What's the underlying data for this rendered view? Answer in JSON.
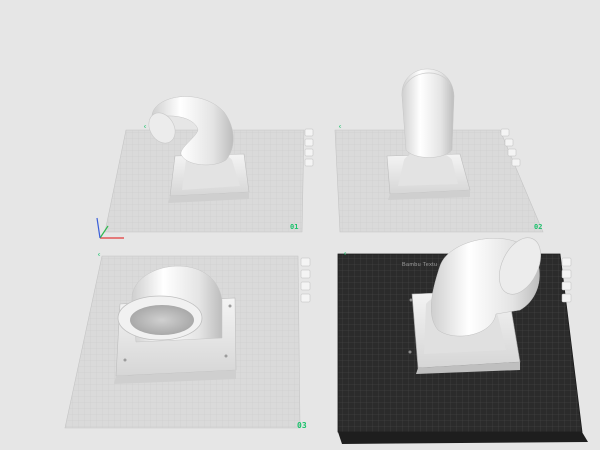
{
  "plates": [
    {
      "id": "plate-1",
      "label": "01",
      "surface": "light-grid",
      "model": "elbow-duct-angled"
    },
    {
      "id": "plate-2",
      "label": "02",
      "surface": "light-grid",
      "model": "elbow-duct-upright"
    },
    {
      "id": "plate-3",
      "label": "03",
      "surface": "light-grid",
      "model": "elbow-duct-facing-front",
      "selected": true
    },
    {
      "id": "plate-4",
      "label": "",
      "surface": "dark-textured-pei",
      "model": "elbow-duct-angled",
      "brand_text": "Bambu Textu"
    }
  ],
  "plate_tools": [
    "plate-arrange-icon",
    "plate-orient-icon",
    "plate-lock-icon",
    "plate-settings-icon"
  ],
  "axes": {
    "x_color": "#e23b3b",
    "y_color": "#2fb84f",
    "z_color": "#3a5fd9"
  },
  "colors": {
    "background": "#e6e6e6",
    "plate_light": "#d9d9d9",
    "plate_dark": "#2c2c2c",
    "accent": "#19c26b",
    "model": "#ededed"
  }
}
